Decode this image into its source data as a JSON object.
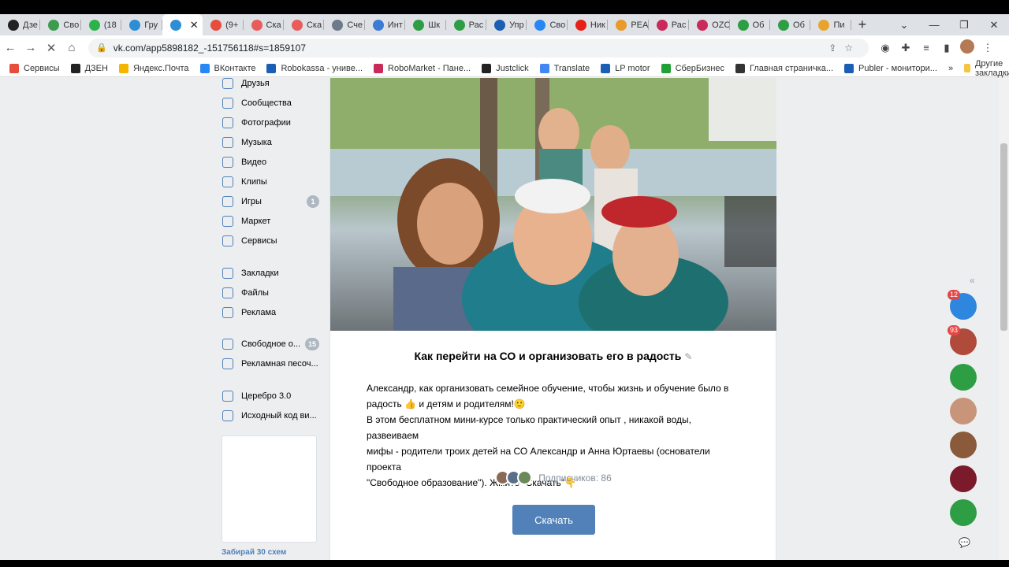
{
  "browser": {
    "tabs": [
      {
        "label": "Дзе",
        "color": "#222"
      },
      {
        "label": "Сво",
        "color": "#3b9c4e"
      },
      {
        "label": "(18",
        "color": "#2bb34a"
      },
      {
        "label": "Гру",
        "color": "#2c8fd6"
      },
      {
        "label": "",
        "color": "#2c8fd6",
        "active": true
      },
      {
        "label": "(9+",
        "color": "#e74c3c"
      },
      {
        "label": "Ска",
        "color": "#e85c5c"
      },
      {
        "label": "Ска",
        "color": "#e85c5c"
      },
      {
        "label": "Сче",
        "color": "#6c7a89"
      },
      {
        "label": "Инт",
        "color": "#3a7bd5"
      },
      {
        "label": "Шк",
        "color": "#2e9e44"
      },
      {
        "label": "Рас",
        "color": "#2e9e44"
      },
      {
        "label": "Упр",
        "color": "#1a5fb4"
      },
      {
        "label": "Сво",
        "color": "#2787f5"
      },
      {
        "label": "Ник",
        "color": "#e62117"
      },
      {
        "label": "РЕА",
        "color": "#e89a2c"
      },
      {
        "label": "Рас",
        "color": "#c92a5a"
      },
      {
        "label": "OZC",
        "color": "#c92a5a"
      },
      {
        "label": "Об",
        "color": "#2e9e44"
      },
      {
        "label": "Об",
        "color": "#2e9e44"
      },
      {
        "label": "Пи",
        "color": "#e8a32c"
      }
    ],
    "url": "vk.com/app5898182_-151756118#s=1859107",
    "bookmarks": [
      {
        "label": "Сервисы",
        "color": "#e74c3c"
      },
      {
        "label": "ДЗЕН",
        "color": "#222"
      },
      {
        "label": "Яндекс.Почта",
        "color": "#f4b400"
      },
      {
        "label": "ВКонтакте",
        "color": "#2787f5"
      },
      {
        "label": "Robokassa - униве...",
        "color": "#1a5fb4"
      },
      {
        "label": "RoboMarket - Пане...",
        "color": "#c92a5a"
      },
      {
        "label": "Justclick",
        "color": "#222"
      },
      {
        "label": "Translate",
        "color": "#4285f4"
      },
      {
        "label": "LP motor",
        "color": "#1a5fb4"
      },
      {
        "label": "СберБизнес",
        "color": "#21a038"
      },
      {
        "label": "Главная страничка...",
        "color": "#333"
      },
      {
        "label": "Publer - монитори...",
        "color": "#1a5fb4"
      }
    ],
    "other_bookmarks": "Другие закладки"
  },
  "sidebar": {
    "items": [
      {
        "label": "Друзья",
        "icon": "friends-icon"
      },
      {
        "label": "Сообщества",
        "icon": "communities-icon"
      },
      {
        "label": "Фотографии",
        "icon": "photos-icon"
      },
      {
        "label": "Музыка",
        "icon": "music-icon"
      },
      {
        "label": "Видео",
        "icon": "video-icon"
      },
      {
        "label": "Клипы",
        "icon": "clips-icon"
      },
      {
        "label": "Игры",
        "icon": "games-icon",
        "badge": "1"
      },
      {
        "label": "Маркет",
        "icon": "market-icon"
      },
      {
        "label": "Сервисы",
        "icon": "services-icon"
      }
    ],
    "items2": [
      {
        "label": "Закладки",
        "icon": "bookmark-icon"
      },
      {
        "label": "Файлы",
        "icon": "files-icon"
      },
      {
        "label": "Реклама",
        "icon": "ads-icon"
      }
    ],
    "items3": [
      {
        "label": "Свободное о...",
        "icon": "group-icon",
        "badge": "15"
      },
      {
        "label": "Рекламная песоч...",
        "icon": "group-icon"
      }
    ],
    "items4": [
      {
        "label": "Церебро 3.0",
        "icon": "app-icon"
      },
      {
        "label": "Исходный код ви...",
        "icon": "app-icon"
      }
    ],
    "footer": "Забирай 30 схем"
  },
  "main": {
    "title": "Как перейти на СО и организовать его в радость",
    "desc_lines": [
      "Александр, как организовать семейное обучение, чтобы жизнь и обучение было в",
      "радость 👍 и детям и родителям!🙂",
      "В этом бесплатном мини-курсе только практический опыт , никакой воды, развеиваем",
      "мифы - родители троих детей на СО Александр и Анна Юртаевы (основатели проекта",
      "\"Свободное образование\"). Жмите \"Скачать\"👇"
    ],
    "subscribers": "Подписчиков: 86",
    "button": "Скачать"
  },
  "right_panel": {
    "badges": [
      "12",
      "93"
    ]
  }
}
